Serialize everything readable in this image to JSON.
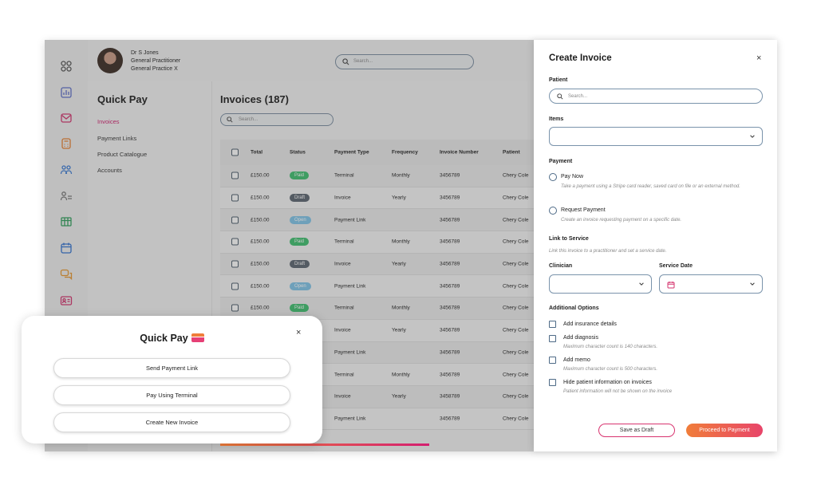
{
  "user": {
    "name": "Dr S Jones",
    "role": "General Practitioner",
    "practice": "General Practice X"
  },
  "top_search": {
    "placeholder": "Search..."
  },
  "iconbar": {
    "icons": [
      "apps-icon",
      "chart-icon",
      "mail-icon",
      "calculator-icon",
      "users-icon",
      "user-list-icon",
      "table-icon",
      "calendar-icon",
      "chat-icon",
      "id-card-icon"
    ]
  },
  "sidenav": {
    "title": "Quick Pay",
    "items": [
      {
        "label": "Invoices",
        "active": true
      },
      {
        "label": "Payment Links",
        "active": false
      },
      {
        "label": "Product Catalogue",
        "active": false
      },
      {
        "label": "Accounts",
        "active": false
      }
    ]
  },
  "invoices": {
    "title": "Invoices (187)",
    "search_placeholder": "Search...",
    "columns": [
      "Total",
      "Status",
      "Payment Type",
      "Frequency",
      "Invoice Number",
      "Patient"
    ],
    "rows": [
      {
        "total": "£150.00",
        "status": "Paid",
        "type": "Terminal",
        "frequency": "Monthly",
        "number": "3456789",
        "patient": "Chery Cole"
      },
      {
        "total": "£150.00",
        "status": "Draft",
        "type": "Invoice",
        "frequency": "Yearly",
        "number": "3456789",
        "patient": "Chery Cole"
      },
      {
        "total": "£150.00",
        "status": "Open",
        "type": "Payment Link",
        "frequency": "",
        "number": "3456789",
        "patient": "Chery Cole"
      },
      {
        "total": "£150.00",
        "status": "Paid",
        "type": "Terminal",
        "frequency": "Monthly",
        "number": "3456789",
        "patient": "Chery Cole"
      },
      {
        "total": "£150.00",
        "status": "Draft",
        "type": "Invoice",
        "frequency": "Yearly",
        "number": "3456789",
        "patient": "Chery Cole"
      },
      {
        "total": "£150.00",
        "status": "Open",
        "type": "Payment Link",
        "frequency": "",
        "number": "3456789",
        "patient": "Chery Cole"
      },
      {
        "total": "£150.00",
        "status": "Paid",
        "type": "Terminal",
        "frequency": "Monthly",
        "number": "3456789",
        "patient": "Chery Cole"
      },
      {
        "total": "",
        "status": "",
        "type": "Invoice",
        "frequency": "Yearly",
        "number": "3456789",
        "patient": "Chery Cole"
      },
      {
        "total": "",
        "status": "",
        "type": "Payment Link",
        "frequency": "",
        "number": "3456789",
        "patient": "Chery Cole"
      },
      {
        "total": "",
        "status": "",
        "type": "Terminal",
        "frequency": "Monthly",
        "number": "3456789",
        "patient": "Chery Cole"
      },
      {
        "total": "",
        "status": "",
        "type": "Invoice",
        "frequency": "Yearly",
        "number": "3458789",
        "patient": "Chery Cole"
      },
      {
        "total": "",
        "status": "",
        "type": "Payment Link",
        "frequency": "",
        "number": "3456789",
        "patient": "Chery Cole"
      }
    ],
    "status_colors": {
      "Paid": "#3dbf6e",
      "Draft": "#5b6470",
      "Open": "#7fc4e8"
    }
  },
  "quickpay_modal": {
    "title": "Quick Pay",
    "close": "×",
    "buttons": [
      "Send Payment Link",
      "Pay Using Terminal",
      "Create New Invoice"
    ]
  },
  "create_invoice": {
    "title": "Create Invoice",
    "close": "×",
    "patient_label": "Patient",
    "patient_placeholder": "Search...",
    "items_label": "Items",
    "payment_label": "Payment",
    "pay_now": {
      "label": "Pay Now",
      "hint": "Take a payment using a Stripe card reader, saved card on file or an external method."
    },
    "request_payment": {
      "label": "Request Payment",
      "hint": "Create an invoice requesting payment on a specific date."
    },
    "link_label": "Link to Service",
    "link_hint": "Link this invoice to a practitioner and set a service date.",
    "clinician_label": "Clinician",
    "service_date_label": "Service Date",
    "additional_label": "Additional Options",
    "options": [
      {
        "label": "Add insurance details",
        "hint": ""
      },
      {
        "label": "Add diagnosis",
        "hint": "Maximum character count is 140 characters."
      },
      {
        "label": "Add memo",
        "hint": "Maximum character count is 500 characters."
      },
      {
        "label": "Hide patient information on invoices",
        "hint": "Patient information will not be shown on the invoice"
      }
    ],
    "save_draft": "Save as Draft",
    "proceed": "Proceed to Payment"
  },
  "colors": {
    "accent": "#d01f6e",
    "gradient_start": "#f07d3a",
    "gradient_end": "#e8456a"
  }
}
